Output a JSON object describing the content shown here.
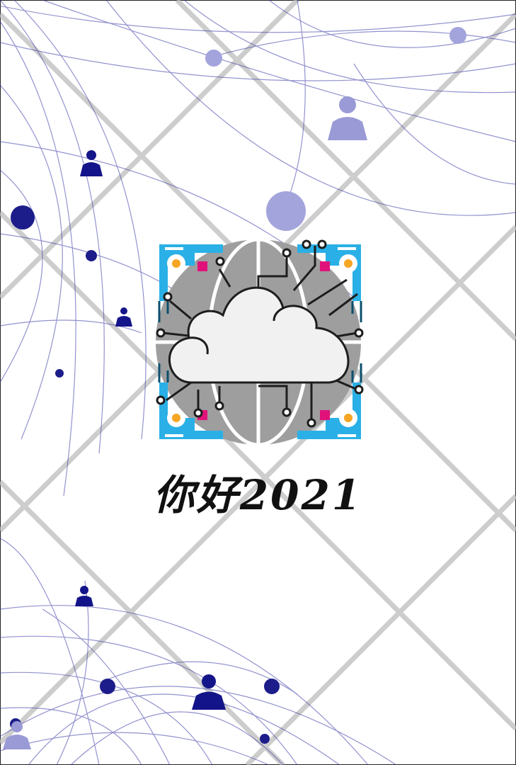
{
  "greeting": {
    "text": "你好2021"
  },
  "colors": {
    "network_line": "#3a3aa8",
    "node_dark": "#1c1c8a",
    "node_light": "#a4a4dc",
    "person_dark": "#14148a",
    "person_light": "#9a9ad6",
    "diamond_grid": "#b8b8b8",
    "circuit_blue": "#2ab0e6",
    "chip_magenta": "#e0127a",
    "globe_gray": "#9e9e9e",
    "cloud_fill": "#f1f1f1"
  },
  "icons": [
    "network-node-icon",
    "person-icon",
    "cloud-computing-icon",
    "globe-icon",
    "circuit-board-icon"
  ]
}
